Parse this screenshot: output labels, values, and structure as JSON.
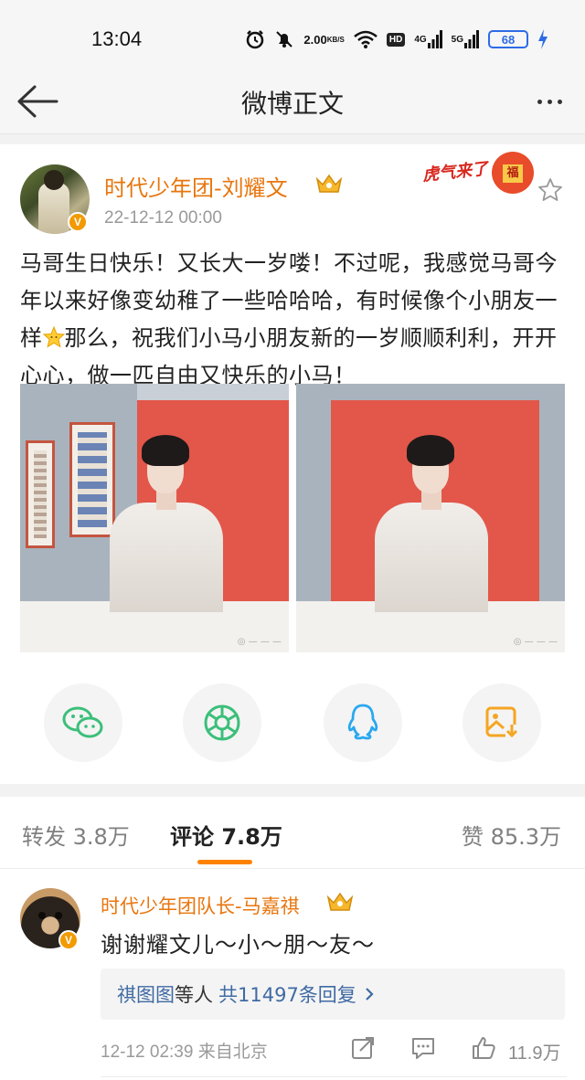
{
  "status_bar": {
    "time": "13:04",
    "network_speed_value": "2.00",
    "network_speed_unit": "KB/S",
    "hd_label": "HD",
    "sim1_type": "4G",
    "sim2_type": "5G",
    "battery_level": "68",
    "icons": [
      "alarm-icon",
      "mute-icon",
      "wifi-icon",
      "signal-icon",
      "battery-icon",
      "charging-icon"
    ]
  },
  "nav": {
    "title": "微博正文",
    "back_icon": "back-arrow-icon",
    "more_icon": "more-dots-icon"
  },
  "post": {
    "author": "时代少年团-刘耀文",
    "timestamp": "22-12-12 00:00",
    "sticker_text": "虎气来了",
    "sticker_badge": "福",
    "text_before_emoji": "马哥生日快乐！又长大一岁喽！不过呢，我感觉马哥今年以来好像变幼稚了一些哈哈哈，有时候像个小朋友一样",
    "text_after_emoji": "那么，祝我们小马小朋友新的一岁顺顺利利，开开心心，做一匹自由又快乐的小马！",
    "image_count": 2
  },
  "share": [
    {
      "icon": "wechat-icon",
      "color": "#3bbf7a"
    },
    {
      "icon": "moments-icon",
      "color": "#3bbf7a"
    },
    {
      "icon": "qq-icon",
      "color": "#29a8f0"
    },
    {
      "icon": "save-image-icon",
      "color": "#f5a623"
    }
  ],
  "tabs": [
    {
      "label": "转发",
      "count": "3.8万",
      "active": false
    },
    {
      "label": "评论",
      "count": "7.8万",
      "active": true
    },
    {
      "label": "赞",
      "count": "85.3万",
      "active": false
    }
  ],
  "comment": {
    "author": "时代少年团队长-马嘉祺",
    "text": "谢谢耀文儿～小～朋～友～",
    "reply_preview": {
      "user": "祺图图",
      "middle": "等人",
      "count": "共11497条回复"
    },
    "date_time": "12-12 02:39",
    "location": "来自北京",
    "likes": "11.9万"
  },
  "colors": {
    "accent_orange": "#ff8200",
    "username_orange": "#e8760e",
    "link_blue": "#3f6aa3"
  }
}
